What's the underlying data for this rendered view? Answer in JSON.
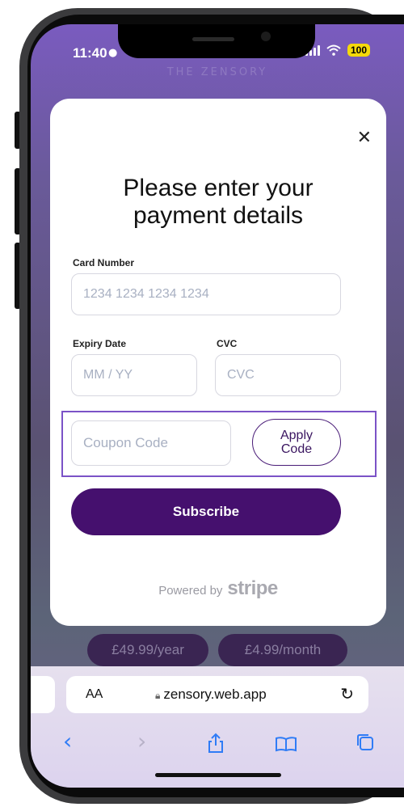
{
  "status_bar": {
    "time": "11:40",
    "battery": "100"
  },
  "background": {
    "brand": "THE ZENSORY"
  },
  "modal": {
    "title_line1": "Please enter your",
    "title_line2": "payment details",
    "card_number": {
      "label": "Card Number",
      "placeholder": "1234 1234 1234 1234",
      "value": ""
    },
    "expiry": {
      "label": "Expiry Date",
      "placeholder": "MM / YY",
      "value": ""
    },
    "cvc": {
      "label": "CVC",
      "placeholder": "CVC",
      "value": ""
    },
    "coupon": {
      "placeholder": "Coupon Code",
      "value": ""
    },
    "apply_line1": "Apply",
    "apply_line2": "Code",
    "subscribe_label": "Subscribe",
    "powered_by": "Powered by",
    "stripe": "stripe"
  },
  "prices": {
    "yearly": "£49.99/year",
    "monthly": "£4.99/month"
  },
  "browser": {
    "aa": "AA",
    "url": "zensory.web.app"
  },
  "colors": {
    "accent": "#45106e",
    "highlight": "#7b52c7",
    "safari_blue": "#2f7cf6"
  },
  "icons": [
    "close-icon",
    "lock-icon",
    "reload-icon",
    "back-icon",
    "forward-icon",
    "share-icon",
    "bookmarks-icon",
    "tabs-icon"
  ]
}
